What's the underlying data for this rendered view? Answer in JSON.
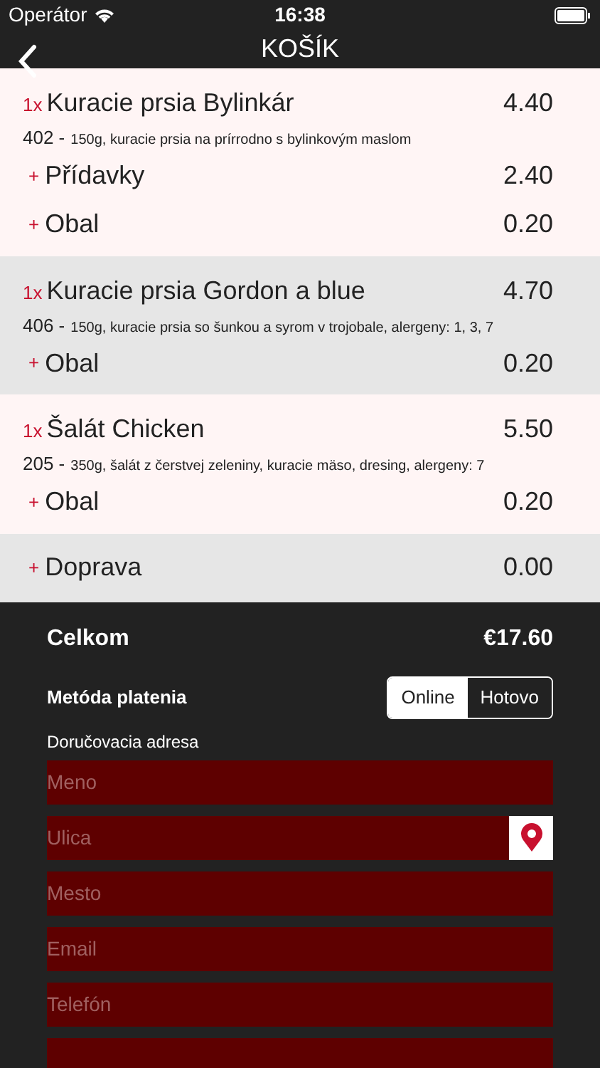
{
  "status_bar": {
    "carrier": "Operátor",
    "time": "16:38"
  },
  "nav": {
    "title": "KOŠÍK"
  },
  "cart_items": [
    {
      "qty": "1x",
      "name": "Kuracie prsia Bylinkár",
      "price": "4.40",
      "code": "402 -",
      "description": "150g, kuracie prsia na prírrodno s bylinkovým maslom",
      "extras": [
        {
          "mark": "+",
          "name": "Přídavky",
          "price": "2.40"
        },
        {
          "mark": "+",
          "name": "Obal",
          "price": "0.20"
        }
      ]
    },
    {
      "qty": "1x",
      "name": "Kuracie prsia Gordon a blue",
      "price": "4.70",
      "code": "406 -",
      "description": "150g, kuracie prsia so šunkou a syrom v trojobale, alergeny: 1, 3, 7",
      "extras": [
        {
          "mark": "+",
          "name": "Obal",
          "price": "0.20"
        }
      ]
    },
    {
      "qty": "1x",
      "name": "Šalát Chicken",
      "price": "5.50",
      "code": "205 -",
      "description": "350g, šalát z čerstvej zeleniny, kuracie mäso, dresing, alergeny: 7",
      "extras": [
        {
          "mark": "+",
          "name": "Obal",
          "price": "0.20"
        }
      ]
    }
  ],
  "delivery": {
    "mark": "+",
    "name": "Doprava",
    "price": "0.00"
  },
  "total": {
    "label": "Celkom",
    "value": "€17.60"
  },
  "payment": {
    "label": "Metóda platenia",
    "options": [
      {
        "label": "Online",
        "selected": true
      },
      {
        "label": "Hotovo",
        "selected": false
      }
    ]
  },
  "address_label": "Doručovacia adresa",
  "fields": [
    {
      "kind": "text",
      "placeholder": "Meno"
    },
    {
      "kind": "location",
      "placeholder": "Ulica"
    },
    {
      "kind": "text",
      "placeholder": "Mesto"
    },
    {
      "kind": "text",
      "placeholder": "Email"
    },
    {
      "kind": "text",
      "placeholder": "Telefón"
    },
    {
      "kind": "cut"
    }
  ]
}
